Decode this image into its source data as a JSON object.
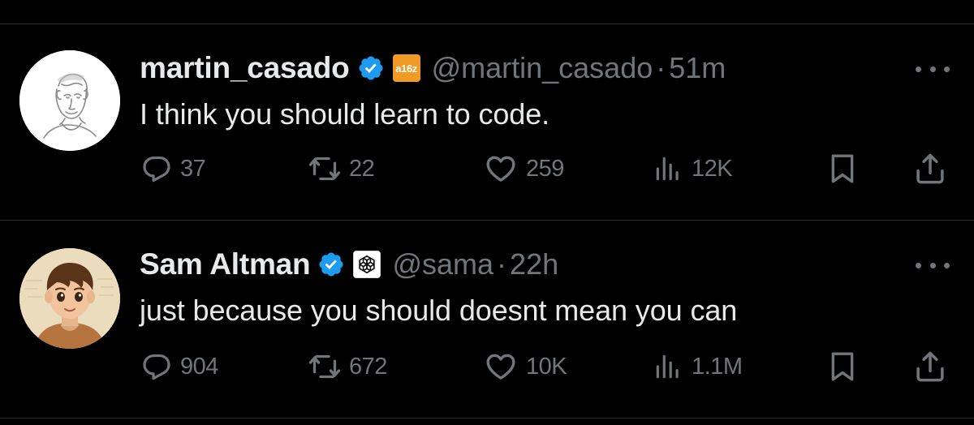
{
  "colors": {
    "background": "#000000",
    "text": "#e7e9ea",
    "muted": "#71767b",
    "verified": "#1d9bf0",
    "divider": "#2a2d31",
    "a16z_badge": "#f29a26"
  },
  "tweets": [
    {
      "display_name": "martin_casado",
      "handle": "@martin_casado",
      "separator": "·",
      "time": "51m",
      "affiliation_badge": {
        "text": "a16z",
        "icon": "a16z-logo"
      },
      "text": "I think you should learn to code.",
      "stats": {
        "replies": "37",
        "reposts": "22",
        "likes": "259",
        "views": "12K"
      }
    },
    {
      "display_name": "Sam Altman",
      "handle": "@sama",
      "separator": "·",
      "time": "22h",
      "affiliation_badge": {
        "icon": "openai-logo"
      },
      "text": "just because you should doesnt mean you can",
      "stats": {
        "replies": "904",
        "reposts": "672",
        "likes": "10K",
        "views": "1.1M"
      }
    }
  ],
  "icons": {
    "verified": "verified-badge-icon",
    "more": "more-icon",
    "reply": "reply-icon",
    "repost": "repost-icon",
    "like": "heart-icon",
    "views": "analytics-icon",
    "bookmark": "bookmark-icon",
    "share": "share-icon"
  }
}
